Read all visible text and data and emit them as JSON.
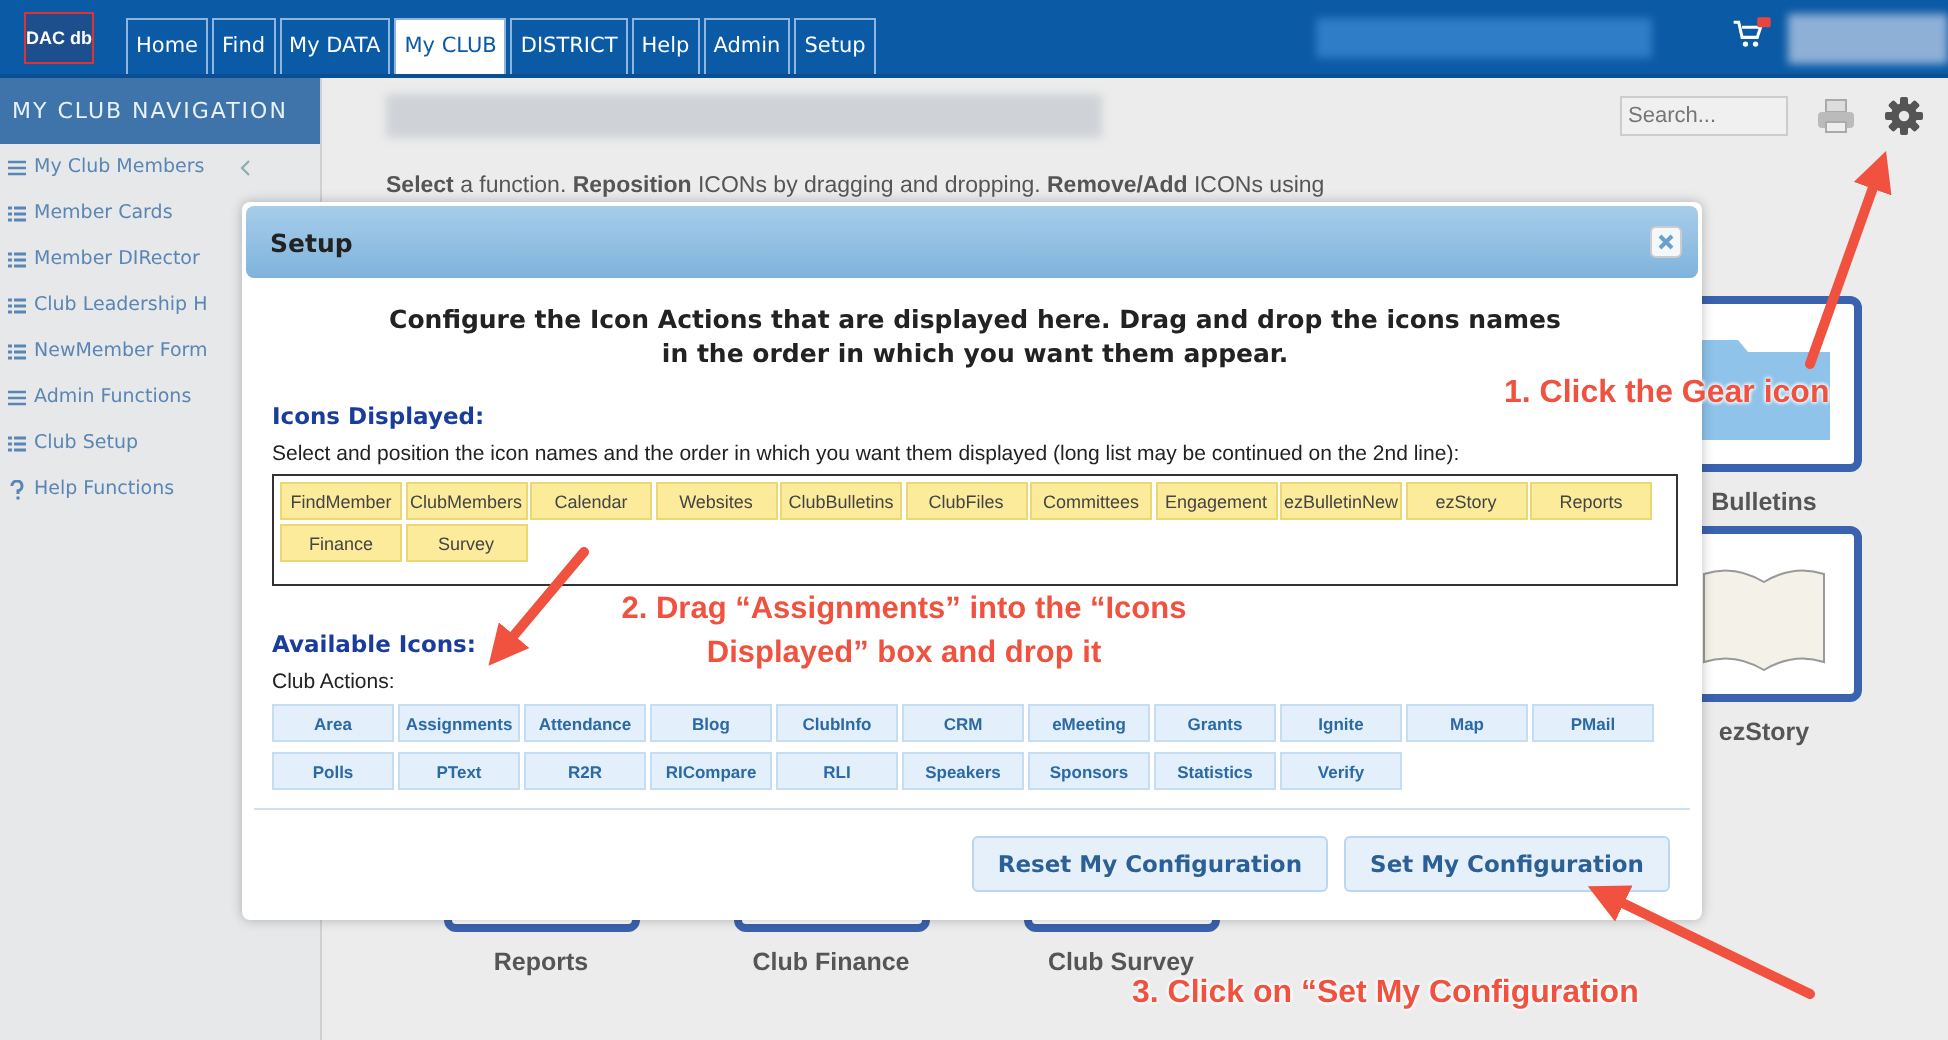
{
  "topbar": {
    "logo": "DAC db",
    "tabs": [
      {
        "label": "Home",
        "selected": false
      },
      {
        "label": "Find",
        "selected": false
      },
      {
        "label": "My DATA",
        "selected": false
      },
      {
        "label": "My CLUB",
        "selected": true
      },
      {
        "label": "DISTRICT",
        "selected": false
      },
      {
        "label": "Help",
        "selected": false
      },
      {
        "label": "Admin",
        "selected": false
      },
      {
        "label": "Setup",
        "selected": false
      }
    ]
  },
  "sidebar": {
    "title": "MY CLUB NAVIGATION",
    "items": [
      {
        "label": "My Club Members",
        "kind": "menu",
        "collapsible": true
      },
      {
        "label": "Member Cards",
        "kind": "list",
        "collapsible": false
      },
      {
        "label": "Member DIRector",
        "kind": "list",
        "collapsible": false
      },
      {
        "label": "Club Leadership H",
        "kind": "list",
        "collapsible": false
      },
      {
        "label": "NewMember Form",
        "kind": "list",
        "collapsible": false
      },
      {
        "label": "Admin Functions",
        "kind": "menu",
        "collapsible": false
      },
      {
        "label": "Club Setup",
        "kind": "list",
        "collapsible": false
      },
      {
        "label": "Help Functions",
        "kind": "help",
        "collapsible": false
      }
    ]
  },
  "main": {
    "search": {
      "placeholder": "Search..."
    },
    "instruction": "**Select** a function. **Reposition** ICONs by dragging and dropping. **Remove/Add** ICONs using",
    "tiles": [
      {
        "label": "Bulletins",
        "kind": "folder"
      },
      {
        "label": "ezStory",
        "kind": "book"
      },
      {
        "label": "Reports",
        "kind": "plain"
      },
      {
        "label": "Club Finance",
        "kind": "plain"
      },
      {
        "label": "Club Survey",
        "kind": "plain"
      }
    ]
  },
  "dialog": {
    "title": "Setup",
    "heading": "Configure the Icon Actions that are displayed here. Drag and drop the icons names in the order in which you want them appear.",
    "displayed": {
      "title": "Icons Displayed:",
      "description": "Select and position the icon names and the order in which you want them displayed (long list may be continued on the 2nd line):",
      "icons": [
        "FindMember",
        "ClubMembers",
        "Calendar",
        "Websites",
        "ClubBulletins",
        "ClubFiles",
        "Committees",
        "Engagement",
        "ezBulletinNew",
        "ezStory",
        "Reports",
        "Finance",
        "Survey"
      ]
    },
    "available": {
      "title": "Available Icons:",
      "group": "Club Actions:",
      "icons": [
        "Area",
        "Assignments",
        "Attendance",
        "Blog",
        "ClubInfo",
        "CRM",
        "eMeeting",
        "Grants",
        "Ignite",
        "Map",
        "PMail",
        "Polls",
        "PText",
        "R2R",
        "RICompare",
        "RLI",
        "Speakers",
        "Sponsors",
        "Statistics",
        "Verify"
      ]
    },
    "buttons": [
      "Reset My Configuration",
      "Set My Configuration"
    ]
  },
  "annotations": [
    "1. Click the Gear icon",
    "2. Drag “Assignments” into the “Icons Displayed” box and drop it",
    "3. Click on “Set My Configuration"
  ]
}
